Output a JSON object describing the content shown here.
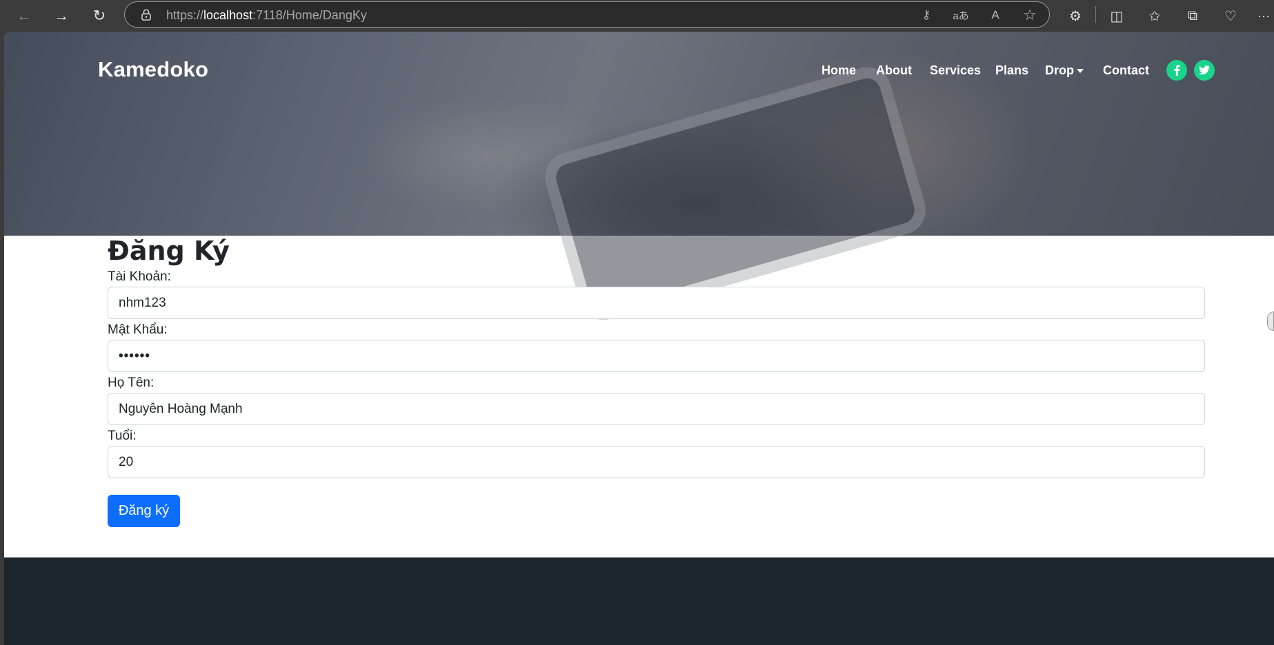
{
  "browser": {
    "url_prefix": "https://",
    "url_host": "localhost",
    "url_rest": ":7118/Home/DangKy",
    "back_icon": "←",
    "forward_icon": "→",
    "reload_icon": "↻",
    "key_icon": "⚷",
    "translate_icon": "aあ",
    "read_aloud_icon": "A",
    "favorite_icon": "☆",
    "extensions_icon": "⚙",
    "split_icon": "◫",
    "favorites_icon": "✩",
    "collections_icon": "⧉",
    "health_icon": "♡",
    "more_icon": "···"
  },
  "site": {
    "brand": "Kamedoko",
    "nav": [
      "Home",
      "About",
      "Services",
      "Plans",
      "Drop",
      "Contact"
    ],
    "social": [
      "f",
      "t"
    ]
  },
  "form": {
    "title": "Đăng Ký",
    "fields": [
      {
        "label": "Tài Khoản:",
        "value": "nhm123"
      },
      {
        "label": "Mật Khẩu:",
        "value": "••••••"
      },
      {
        "label": "Họ Tên:",
        "value": "Nguyễn Hoàng Mạnh"
      },
      {
        "label": "Tuổi:",
        "value": "20"
      }
    ],
    "submit_label": "Đăng ký"
  },
  "colors": {
    "primary": "#0d6efd",
    "social": "#19d48a",
    "footer": "#1c242e"
  }
}
